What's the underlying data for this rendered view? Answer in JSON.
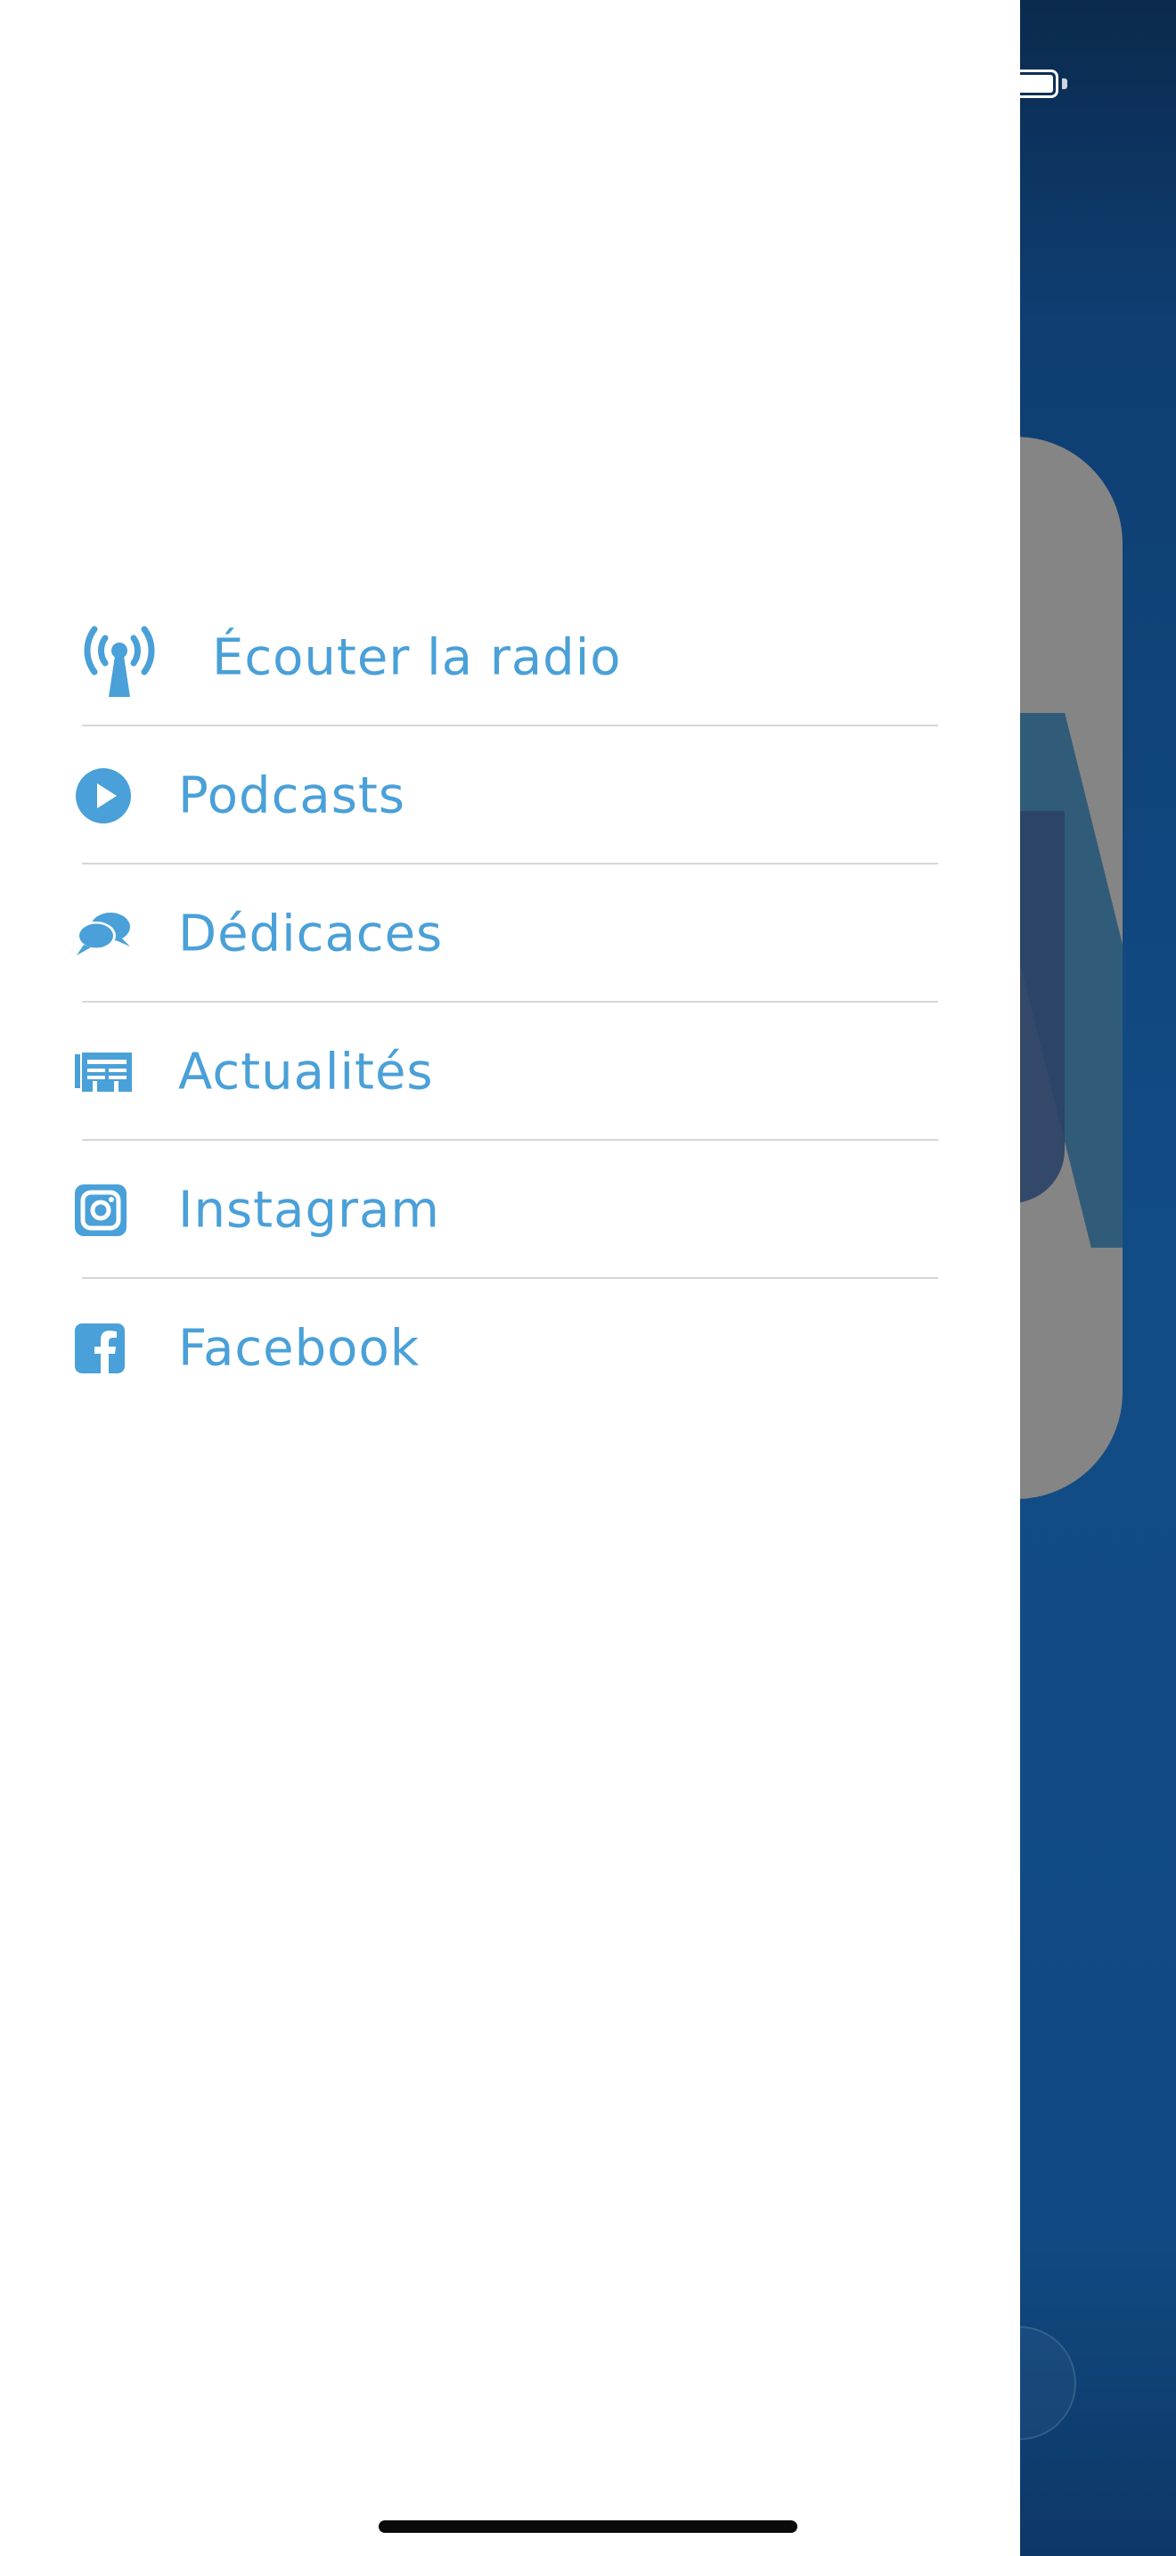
{
  "colors": {
    "accent": "#4aa0d8",
    "drawer_background": "#ffffff",
    "divider": "#d6d6d6",
    "app_background": "#124c85"
  },
  "menu": {
    "items": [
      {
        "label": "Écouter la radio",
        "icon": "radio-antenna-icon"
      },
      {
        "label": "Podcasts",
        "icon": "play-circle-icon"
      },
      {
        "label": "Dédicaces",
        "icon": "chat-bubbles-icon"
      },
      {
        "label": "Actualités",
        "icon": "newspaper-icon"
      },
      {
        "label": "Instagram",
        "icon": "instagram-icon"
      },
      {
        "label": "Facebook",
        "icon": "facebook-icon"
      }
    ]
  }
}
